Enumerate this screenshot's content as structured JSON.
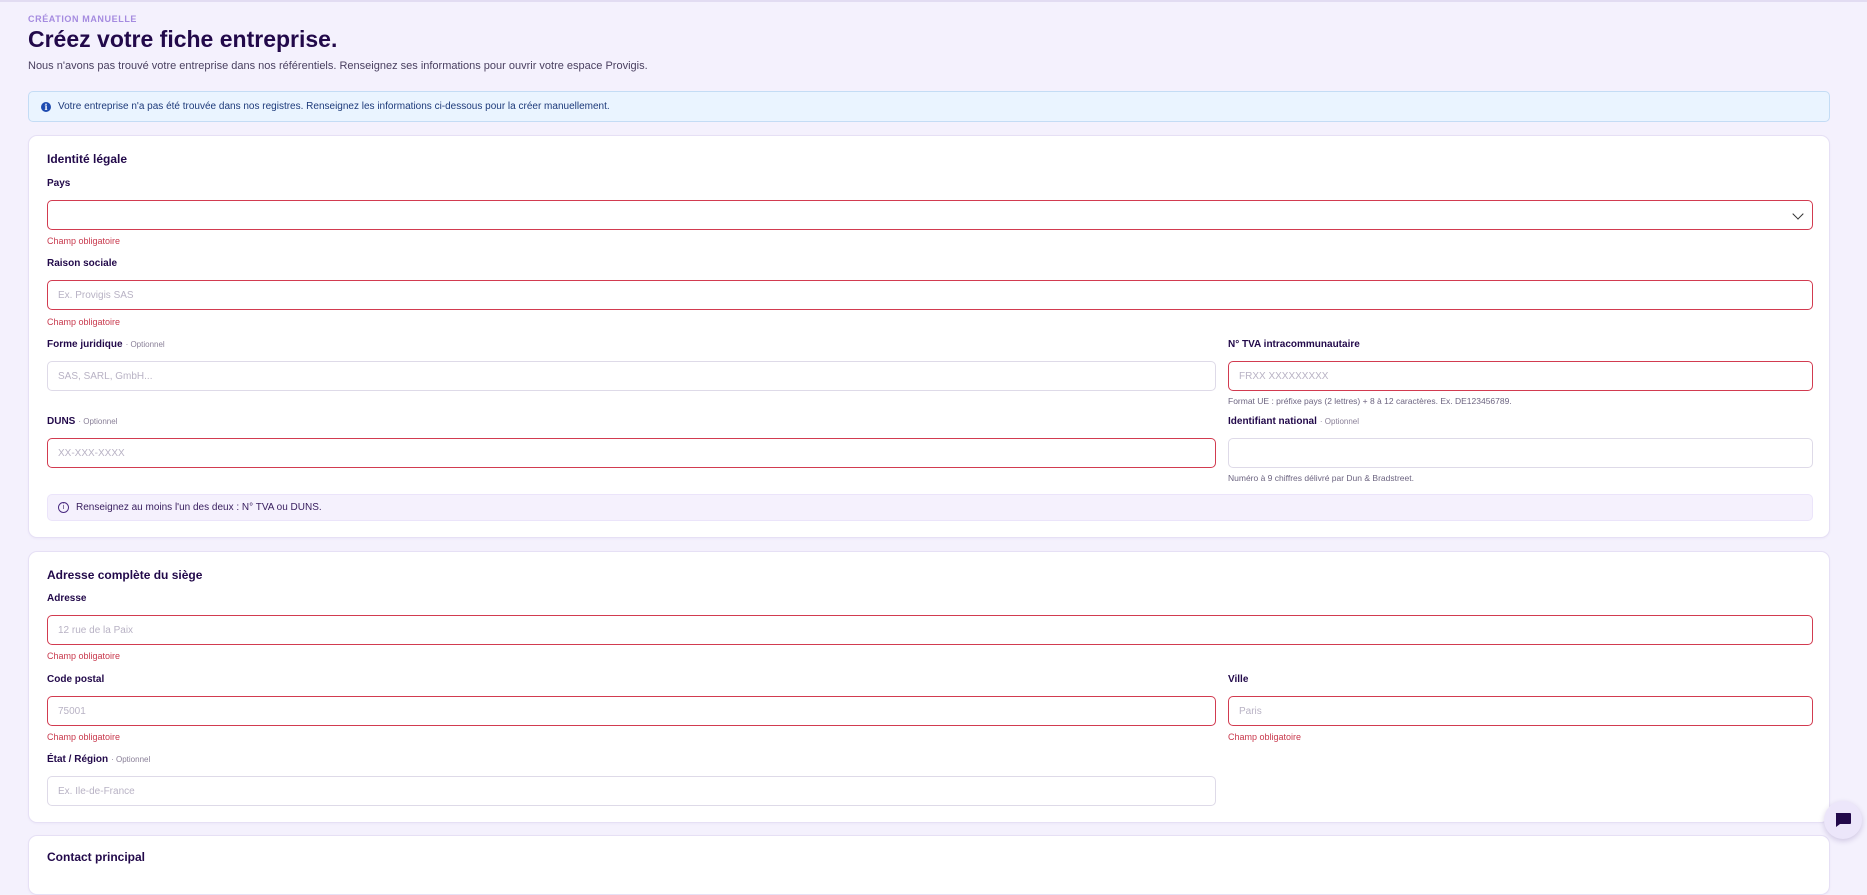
{
  "header": {
    "eyebrow": "CRÉATION MANUELLE",
    "title": "Créez votre fiche entreprise.",
    "subtitle": "Nous n'avons pas trouvé votre entreprise dans nos référentiels. Renseignez ses informations pour ouvrir votre espace Provigis."
  },
  "banner": {
    "icon": "info-icon",
    "text": "Votre entreprise n'a pas été trouvée dans nos registres. Renseignez les informations ci-dessous pour la créer manuellement."
  },
  "legal": {
    "title": "Identité légale",
    "country": {
      "label": "Pays",
      "value": "",
      "error": "Champ obligatoire"
    },
    "company_name": {
      "label": "Raison sociale",
      "placeholder": "Ex. Provigis SAS",
      "error": "Champ obligatoire"
    },
    "legal_form": {
      "label": "Forme juridique",
      "optional": "· Optionnel",
      "placeholder": "SAS, SARL, GmbH..."
    },
    "vat": {
      "label": "N° TVA intracommunautaire",
      "placeholder": "FRXX XXXXXXXXX",
      "help": "Format UE : préfixe pays (2 lettres) + 8 à 12 caractères. Ex. DE123456789."
    },
    "duns": {
      "label": "DUNS",
      "optional": "· Optionnel",
      "placeholder": "XX-XXX-XXXX"
    },
    "national_id": {
      "label": "Identifiant national",
      "optional": "· Optionnel",
      "placeholder": "",
      "help": "Numéro à 9 chiffres délivré par Dun & Bradstreet."
    },
    "note": "Renseignez au moins l'un des deux : N° TVA ou DUNS."
  },
  "address": {
    "title": "Adresse complète du siège",
    "street": {
      "label": "Adresse",
      "placeholder": "12 rue de la Paix",
      "error": "Champ obligatoire"
    },
    "postal": {
      "label": "Code postal",
      "placeholder": "75001",
      "error": "Champ obligatoire"
    },
    "city": {
      "label": "Ville",
      "placeholder": "Paris",
      "error": "Champ obligatoire"
    },
    "region": {
      "label": "État / Région",
      "optional": "· Optionnel",
      "placeholder": "Ex. Ile-de-France"
    }
  },
  "contact": {
    "title": "Contact principal"
  },
  "colors": {
    "accent": "#22094a",
    "error": "#d23b50",
    "background": "#f4f1fd"
  }
}
